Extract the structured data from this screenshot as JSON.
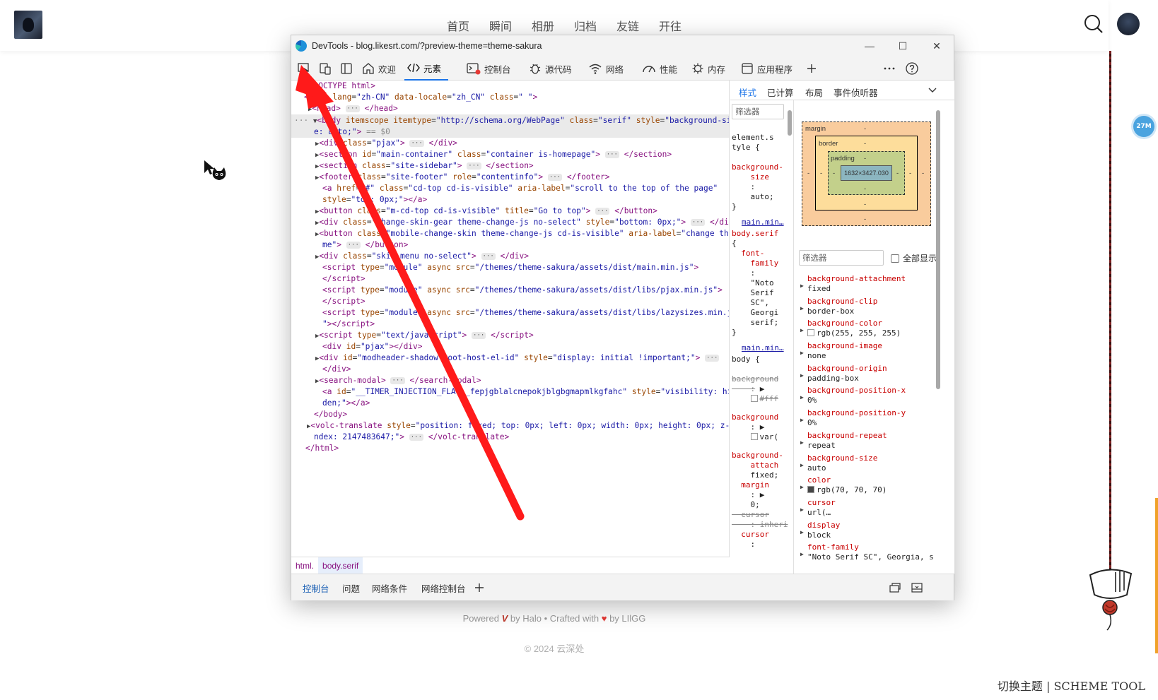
{
  "site": {
    "nav": [
      "首页",
      "瞬间",
      "相册",
      "归档",
      "友链",
      "开往"
    ],
    "badge": "27M",
    "footer_powered_prefix": "Powered",
    "footer_powered_v": "V",
    "footer_powered_mid": "by Halo • Crafted with",
    "footer_powered_suffix": "by LIlGG",
    "footer_copy": "© 2024 云深处",
    "theme_switch": "切换主题 | SCHEME TOOL"
  },
  "devtools": {
    "title": "DevTools - blog.likesrt.com/?preview-theme=theme-sakura",
    "tabs": [
      "欢迎",
      "元素",
      "控制台",
      "源代码",
      "网络",
      "性能",
      "内存",
      "应用程序"
    ],
    "active_tab": "元素",
    "style_tabs": [
      "样式",
      "已计算",
      "布局",
      "事件侦听器"
    ],
    "breadcrumbs": [
      "html.",
      "body.serif"
    ],
    "drawer_tabs": [
      "控制台",
      "问题",
      "网络条件",
      "网络控制台"
    ],
    "styles_filter_placeholder": "筛选器",
    "computed_filter_placeholder": "筛选器",
    "show_all_label": "全部显示",
    "box_model": {
      "margin_label": "margin",
      "border_label": "border",
      "padding_label": "padding",
      "content_size": "1632×3427.030",
      "dash": "-"
    },
    "computed_props": [
      {
        "name": "background-attachment",
        "value": "fixed"
      },
      {
        "name": "background-clip",
        "value": "border-box"
      },
      {
        "name": "background-color",
        "value": "rgb(255, 255, 255)",
        "swatch": "#ffffff"
      },
      {
        "name": "background-image",
        "value": "none"
      },
      {
        "name": "background-origin",
        "value": "padding-box"
      },
      {
        "name": "background-position-x",
        "value": "0%"
      },
      {
        "name": "background-position-y",
        "value": "0%"
      },
      {
        "name": "background-repeat",
        "value": "repeat"
      },
      {
        "name": "background-size",
        "value": "auto"
      },
      {
        "name": "color",
        "value": "rgb(70, 70, 70)",
        "swatch": "#464646"
      },
      {
        "name": "cursor",
        "value": "url(…"
      },
      {
        "name": "display",
        "value": "block"
      },
      {
        "name": "font-family",
        "value": "\"Noto Serif SC\", Georgia, s"
      }
    ]
  },
  "colors": {
    "annotation_arrow": "#ff1a1a",
    "active_tab_underline": "#1a73e8",
    "badge": "#4aa3df"
  }
}
